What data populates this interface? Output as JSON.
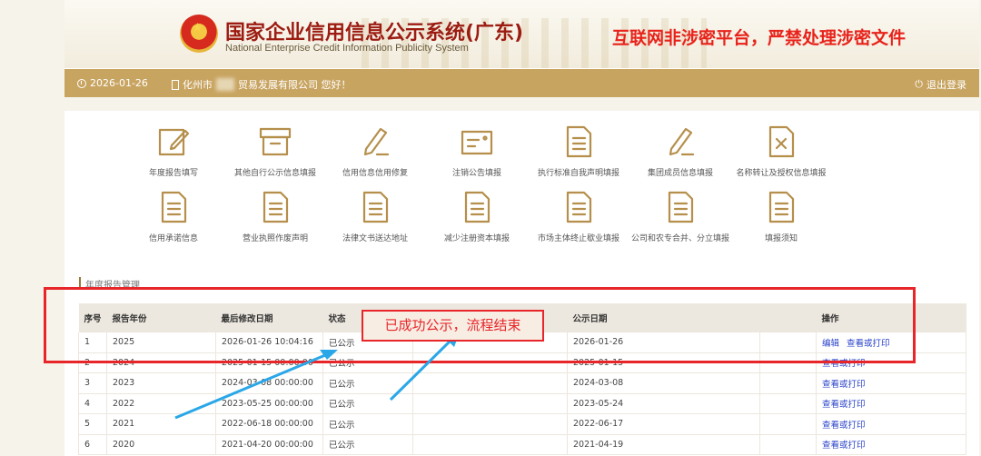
{
  "header": {
    "title": "国家企业信用信息公示系统(广东)",
    "subtitle": "National Enterprise Credit Information Publicity System",
    "warning": "互联网非涉密平台，严禁处理涉密文件"
  },
  "topbar": {
    "date": "2026-01-26",
    "company_prefix": "化州市",
    "company_suffix": "贸易发展有限公司 您好！",
    "logout": "退出登录"
  },
  "tiles_row1": [
    {
      "label": "年度报告填写",
      "icon": "edit-icon"
    },
    {
      "label": "其他自行公示信息填报",
      "icon": "archive-box-icon"
    },
    {
      "label": "信用信息信用修复",
      "icon": "pen-icon"
    },
    {
      "label": "注销公告填报",
      "icon": "card-icon"
    },
    {
      "label": "执行标准自我声明填报",
      "icon": "document-icon"
    },
    {
      "label": "集团成员信息填报",
      "icon": "pen-icon"
    },
    {
      "label": "名称转让及授权信息填报",
      "icon": "document-x-icon"
    }
  ],
  "tiles_row2": [
    {
      "label": "信用承诺信息",
      "icon": "document-icon"
    },
    {
      "label": "营业执照作废声明",
      "icon": "document-icon"
    },
    {
      "label": "法律文书送达地址",
      "icon": "document-icon"
    },
    {
      "label": "减少注册资本填报",
      "icon": "document-icon"
    },
    {
      "label": "市场主体终止歇业填报",
      "icon": "document-icon"
    },
    {
      "label": "公司和农专合并、分立填报",
      "icon": "document-icon"
    },
    {
      "label": "填报须知",
      "icon": "document-icon"
    }
  ],
  "section": {
    "title": "年度报告管理"
  },
  "table": {
    "headers": [
      "序号",
      "报告年份",
      "最后修改日期",
      "状态",
      "",
      "公示日期",
      "",
      "操作"
    ],
    "rows": [
      {
        "no": "1",
        "year": "2025",
        "modified": "2026-01-26 10:04:16",
        "status": "已公示",
        "published": "2026-01-26",
        "actions": [
          "编辑",
          "查看或打印"
        ]
      },
      {
        "no": "2",
        "year": "2024",
        "modified": "2025-01-15 00:00:00",
        "status": "已公示",
        "published": "2025-01-15",
        "actions": [
          "查看或打印"
        ]
      },
      {
        "no": "3",
        "year": "2023",
        "modified": "2024-03-08 00:00:00",
        "status": "已公示",
        "published": "2024-03-08",
        "actions": [
          "查看或打印"
        ]
      },
      {
        "no": "4",
        "year": "2022",
        "modified": "2023-05-25 00:00:00",
        "status": "已公示",
        "published": "2023-05-24",
        "actions": [
          "查看或打印"
        ]
      },
      {
        "no": "5",
        "year": "2021",
        "modified": "2022-06-18 00:00:00",
        "status": "已公示",
        "published": "2022-06-17",
        "actions": [
          "查看或打印"
        ]
      },
      {
        "no": "6",
        "year": "2020",
        "modified": "2021-04-20 00:00:00",
        "status": "已公示",
        "published": "2021-04-19",
        "actions": [
          "查看或打印"
        ]
      }
    ]
  },
  "annotation": {
    "callout": "已成功公示，流程结束"
  },
  "colors": {
    "gold": "#c8a461",
    "title_red": "#9c1c12",
    "annotation_red": "#e8262a",
    "link_blue": "#2a43c9",
    "arrow_blue": "#2aa7e8"
  }
}
